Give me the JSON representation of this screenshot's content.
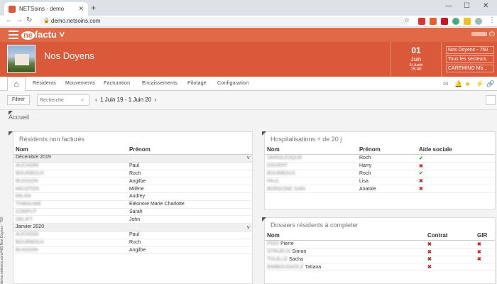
{
  "browser": {
    "tab_title": "NETSoins - demo",
    "url": "demo.netsoins.com",
    "window_controls": [
      "—",
      "☐",
      "✕"
    ]
  },
  "app": {
    "logo_text": "factu",
    "logo_prefix": "ne",
    "establishment": "Nos Doyens",
    "date": {
      "day": "01",
      "month": "Juin",
      "place": "St Justin",
      "time": "15:40"
    },
    "selectors": [
      "Nos Doyens - 750",
      "Tous les secteurs",
      "CAREMINO Mb..."
    ]
  },
  "nav": {
    "items": [
      "Résidents",
      "Mouvements",
      "Facturation",
      "Encaissements",
      "Pilotage",
      "Configuration"
    ],
    "home_icon": "home-icon"
  },
  "filter": {
    "button": "Filtrer",
    "search_placeholder": "Recherche",
    "period": "1 Juin 19 - 1 Juin 20"
  },
  "page_title": "Accueil",
  "side_text": "demo.netsoins.com/468 Nos Doyens - 750",
  "residents_non_factures": {
    "title": "Résidents non facturés",
    "headers": [
      "Nom",
      "Prénom"
    ],
    "groups": [
      {
        "label": "Décembre 2019",
        "rows": [
          [
            "AUCHOIN",
            "Paul"
          ],
          [
            "BOURBOUX",
            "Roch"
          ],
          [
            "BUISSON",
            "Angilbe"
          ],
          [
            "MICOTON",
            "Milène"
          ],
          [
            "MILAN",
            "Audrey"
          ],
          [
            "THIBAUME",
            "Éléonore Marie Charlotte"
          ],
          [
            "CORPUT",
            "Sarah"
          ],
          [
            "DELIFT",
            "John"
          ]
        ]
      },
      {
        "label": "Janvier 2020",
        "rows": [
          [
            "AUCHOIN",
            "Paul"
          ],
          [
            "BOURBOUX",
            "Roch"
          ],
          [
            "BUISSON",
            "Angilbe"
          ]
        ]
      }
    ]
  },
  "hospitalisations": {
    "title": "Hospitalisations + de 20 j",
    "headers": [
      "Nom",
      "Prénom",
      "Aide sociale"
    ],
    "rows": [
      {
        "nom": "VARIOLESQUE",
        "prenom": "Roch",
        "aide": "yes"
      },
      {
        "nom": "DOVERT",
        "prenom": "Harry",
        "aide": "no"
      },
      {
        "nom": "BOURBOUX",
        "prenom": "Roch",
        "aide": "yes"
      },
      {
        "nom": "PAUL",
        "prenom": "Lisa",
        "aide": "no"
      },
      {
        "nom": "BORGONE SIAN",
        "prenom": "Anatole",
        "aide": "no"
      }
    ]
  },
  "dossiers": {
    "title": "Dossiers résidents à completer",
    "headers": [
      "Nom",
      "Contrat",
      "GIR"
    ],
    "rows": [
      {
        "nom_blur": "PIDO",
        "prenom": "Pierre",
        "contrat": "no",
        "gir": "no"
      },
      {
        "nom_blur": "STRUEUX",
        "prenom": "Simon",
        "contrat": "no",
        "gir": "no"
      },
      {
        "nom_blur": "TOUILLE",
        "prenom": "Sacha",
        "contrat": "no",
        "gir": "no"
      },
      {
        "nom_blur": "BIMBOUGAOLE",
        "prenom": "Tatiana",
        "contrat": "no",
        "gir": ""
      }
    ]
  },
  "colors": {
    "brand": "#d9593a",
    "brand_light": "#e06a47",
    "ok": "#2e9e3a",
    "no": "#cc2222"
  }
}
